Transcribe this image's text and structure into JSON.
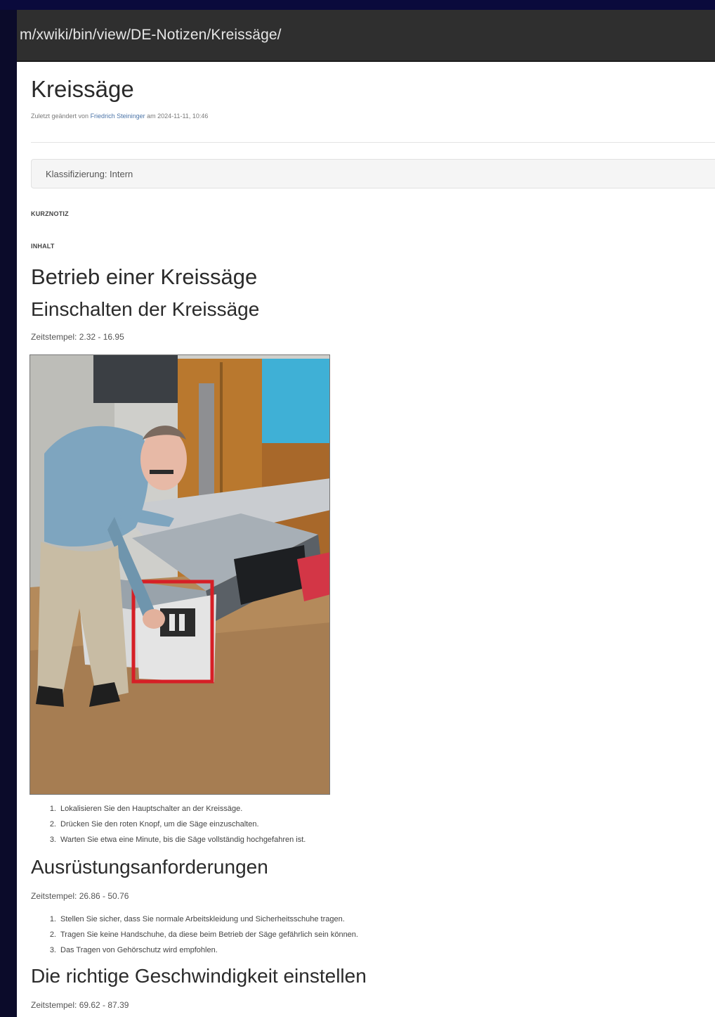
{
  "browser": {
    "url": "m/xwiki/bin/view/DE-Notizen/Kreissäge/"
  },
  "page": {
    "title": "Kreissäge",
    "meta": {
      "prefix": "Zuletzt geändert von ",
      "author": "Friedrich Steininger",
      "suffix": " am 2024-11-11, 10:46"
    },
    "classification": "Klassifizierung: Intern",
    "kurznotiz_label": "KURZNOTIZ",
    "inhalt_label": "INHALT",
    "heading": "Betrieb einer Kreissäge",
    "sections": [
      {
        "title": "Einschalten der Kreissäge",
        "timestamp": "Zeitstempel: 2.32 - 16.95",
        "steps": [
          "Lokalisieren Sie den Hauptschalter an der Kreissäge.",
          "Drücken Sie den roten Knopf, um die Säge einzuschalten.",
          "Warten Sie etwa eine Minute, bis die Säge vollständig hochgefahren ist."
        ]
      },
      {
        "title": "Ausrüstungsanforderungen",
        "timestamp": "Zeitstempel: 26.86 - 50.76",
        "steps": [
          "Stellen Sie sicher, dass Sie normale Arbeitskleidung und Sicherheitsschuhe tragen.",
          "Tragen Sie keine Handschuhe, da diese beim Betrieb der Säge gefährlich sein können.",
          "Das Tragen von Gehörschutz wird empfohlen."
        ]
      },
      {
        "title": "Die richtige Geschwindigkeit einstellen",
        "timestamp": "Zeitstempel: 69.62 - 87.39"
      }
    ],
    "step_numbers": [
      "1.",
      "2.",
      "3."
    ]
  }
}
